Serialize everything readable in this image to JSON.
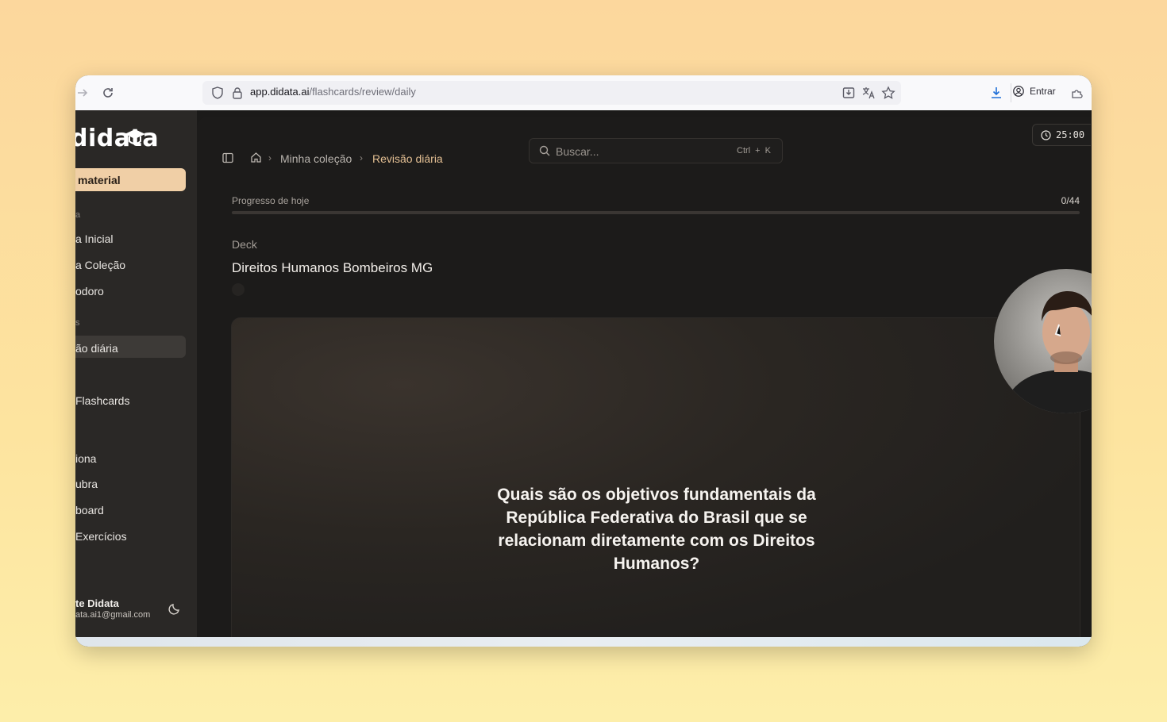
{
  "browser": {
    "url_host": "app.didata.ai",
    "url_path": "/flashcards/review/daily",
    "signin_label": "Entrar"
  },
  "sidebar": {
    "logo": "didata",
    "new_material_label": "material",
    "sections": [
      "a",
      "s"
    ],
    "items": [
      {
        "label": "a Inicial"
      },
      {
        "label": "a Coleção"
      },
      {
        "label": "odoro"
      },
      {
        "label": "ão diária"
      },
      {
        "label": "Flashcards"
      },
      {
        "label": "iona"
      },
      {
        "label": "ubra"
      },
      {
        "label": "board"
      },
      {
        "label": "Exercícios"
      }
    ],
    "user": {
      "name": "te Didata",
      "email": "ata.ai1@gmail.com"
    }
  },
  "header": {
    "breadcrumb": [
      "Minha coleção",
      "Revisão diária"
    ],
    "search_placeholder": "Buscar...",
    "search_shortcut": "Ctrl + K",
    "timer": "25:00"
  },
  "progress": {
    "label": "Progresso de hoje",
    "count": "0/44",
    "fraction": 0
  },
  "deck": {
    "label": "Deck",
    "title": "Direitos Humanos Bombeiros MG"
  },
  "card": {
    "question": "Quais são os objetivos fundamentais da República Federativa do Brasil que se relacionam diretamente com os Direitos Humanos?"
  },
  "colors": {
    "accent": "#e3bf93",
    "new_material_bg": "#f0cfa6",
    "background": "#1c1b1a"
  }
}
